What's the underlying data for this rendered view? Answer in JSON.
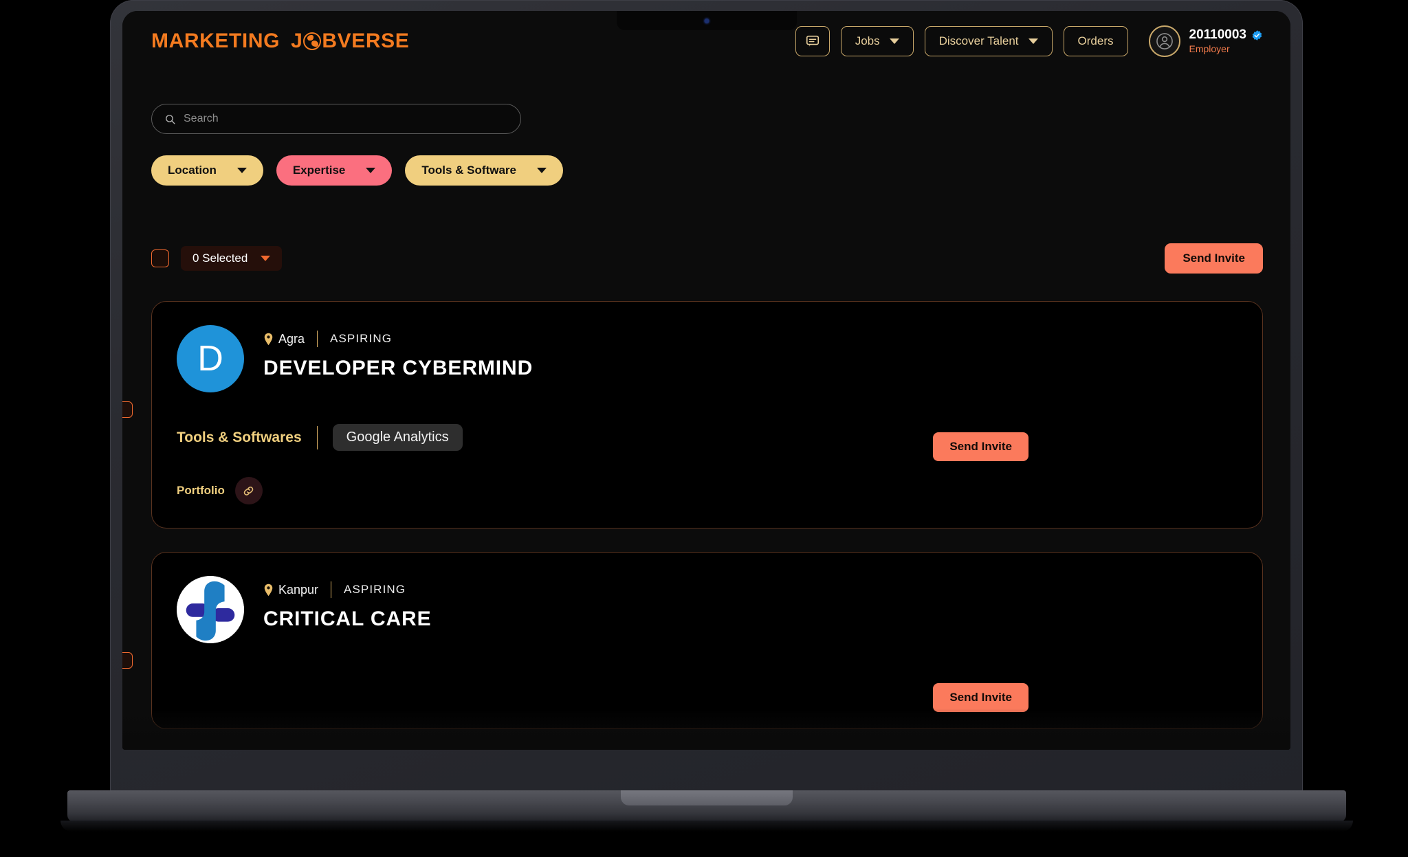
{
  "brand": {
    "word1": "MARKETING",
    "word2_pre": "J",
    "word2_post": "BVERSE",
    "globe_icon": "globe-icon",
    "color": "#f47b20"
  },
  "topnav": {
    "messages_icon": "chat-bubble-icon",
    "jobs_label": "Jobs",
    "discover_talent_label": "Discover Talent",
    "orders_label": "Orders",
    "border_color": "#c9a86a",
    "text_color": "#e8cf9c"
  },
  "profile": {
    "avatar_icon": "user-avatar-icon",
    "id": "20110003",
    "verified_icon": "verified-badge-icon",
    "role": "Employer",
    "role_color": "#f07a4b"
  },
  "search": {
    "placeholder": "Search",
    "value": "",
    "icon": "search-icon"
  },
  "filters": [
    {
      "label": "Location",
      "color": "#f0cf7f",
      "style": "gold",
      "caret": "chevron-down-icon"
    },
    {
      "label": "Expertise",
      "color": "#fb6f7f",
      "style": "pink",
      "caret": "chevron-down-icon"
    },
    {
      "label": "Tools & Software",
      "color": "#f0cf7f",
      "style": "gold",
      "caret": "chevron-down-icon"
    }
  ],
  "selection": {
    "checkbox_checked": false,
    "count_label": "0 Selected",
    "caret": "chevron-down-icon",
    "send_invite_label": "Send Invite",
    "accent": "#f0692f",
    "invite_color": "#fb7a5c"
  },
  "candidates": [
    {
      "checkbox_checked": false,
      "avatar_type": "letter",
      "avatar_letter": "D",
      "avatar_color": "#1f93d9",
      "location": "Agra",
      "location_icon": "map-pin-icon",
      "status": "ASPIRING",
      "name": "DEVELOPER CYBERMIND",
      "send_invite_label": "Send Invite",
      "tools_label": "Tools & Softwares",
      "tools": [
        "Google Analytics"
      ],
      "portfolio_label": "Portfolio",
      "portfolio_icon": "link-icon"
    },
    {
      "checkbox_checked": false,
      "avatar_type": "logo",
      "avatar_letter": "",
      "avatar_color": "#ffffff",
      "location": "Kanpur",
      "location_icon": "map-pin-icon",
      "status": "ASPIRING",
      "name": "CRITICAL CARE",
      "send_invite_label": "Send Invite",
      "tools_label": "",
      "tools": [],
      "portfolio_label": "",
      "portfolio_icon": ""
    }
  ]
}
